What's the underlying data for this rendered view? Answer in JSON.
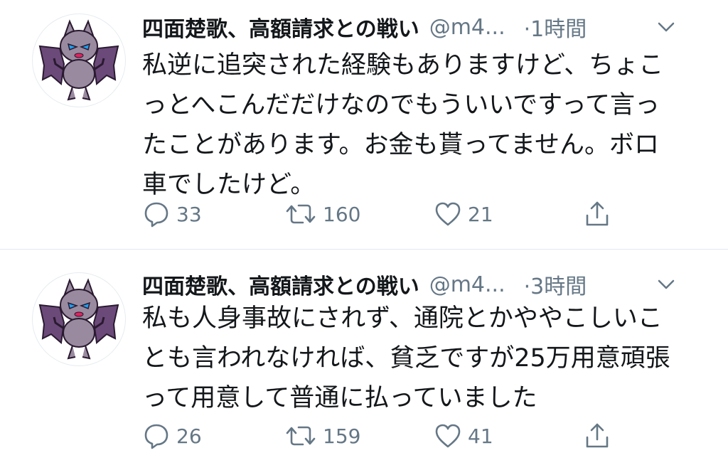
{
  "colors": {
    "text": "#14171a",
    "secondary": "#657786",
    "divider": "#e1e8ed",
    "avatar_wing": "#6b4a7a",
    "avatar_body": "#9a8aa0",
    "avatar_eye": "#1da1f2"
  },
  "icons": {
    "reply": "reply-icon",
    "retweet": "retweet-icon",
    "like": "heart-icon",
    "share": "share-icon",
    "caret": "chevron-down-icon",
    "avatar": "bat-character-avatar"
  },
  "tweets": [
    {
      "display_name": "四面楚歌、高額請求との戦い",
      "handle": "@m4...",
      "time": "·1時間",
      "text_lines": [
        "私逆に追突された経験もありますけど、ちょこ",
        "っとへこんだだけなのでもういいですって言っ",
        "たことがあります。お金も貰ってません。ボロ",
        "車でしたけど。"
      ],
      "replies": "33",
      "retweets": "160",
      "likes": "21"
    },
    {
      "display_name": "四面楚歌、高額請求との戦い",
      "handle": "@m4...",
      "time": "·3時間",
      "text_lines": [
        "私も人身事故にされず、通院とかややこしいこ",
        "とも言われなければ、貧乏ですが25万用意頑張",
        "って用意して普通に払っていました"
      ],
      "replies": "26",
      "retweets": "159",
      "likes": "41"
    }
  ]
}
